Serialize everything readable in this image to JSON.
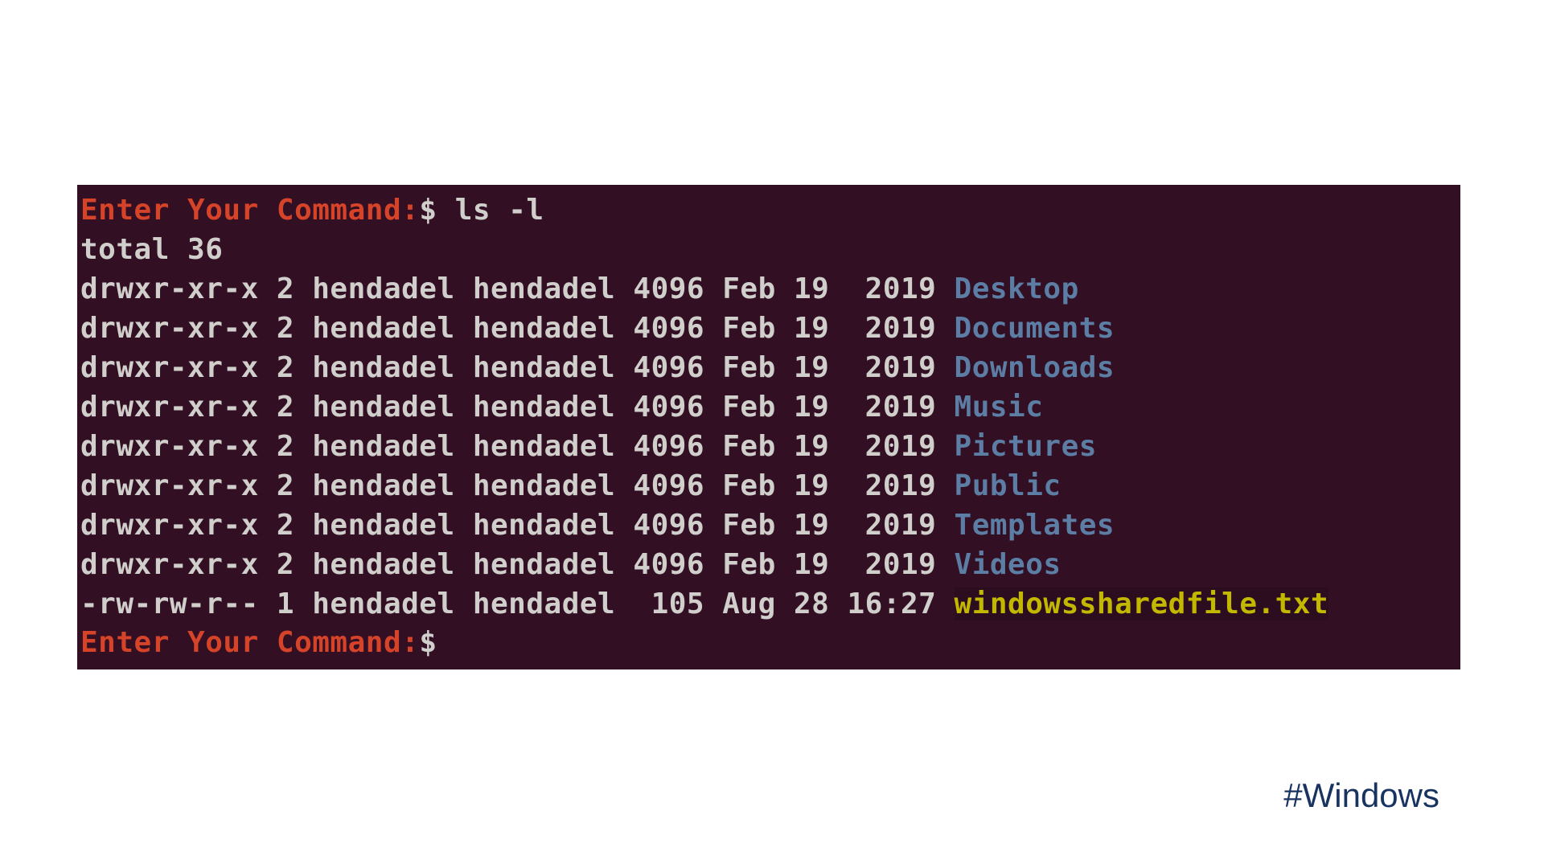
{
  "terminal": {
    "prompt_text": "Enter Your Command:",
    "dollar": "$",
    "command": "ls -l",
    "total_line": "total 36",
    "rows": [
      {
        "perm": "drwxr-xr-x",
        "links": "2",
        "owner": "hendadel",
        "group": "hendadel",
        "size": "4096",
        "month": "Feb",
        "day": "19",
        "timeyear": " 2019",
        "name": "Desktop",
        "kind": "dir"
      },
      {
        "perm": "drwxr-xr-x",
        "links": "2",
        "owner": "hendadel",
        "group": "hendadel",
        "size": "4096",
        "month": "Feb",
        "day": "19",
        "timeyear": " 2019",
        "name": "Documents",
        "kind": "dir"
      },
      {
        "perm": "drwxr-xr-x",
        "links": "2",
        "owner": "hendadel",
        "group": "hendadel",
        "size": "4096",
        "month": "Feb",
        "day": "19",
        "timeyear": " 2019",
        "name": "Downloads",
        "kind": "dir"
      },
      {
        "perm": "drwxr-xr-x",
        "links": "2",
        "owner": "hendadel",
        "group": "hendadel",
        "size": "4096",
        "month": "Feb",
        "day": "19",
        "timeyear": " 2019",
        "name": "Music",
        "kind": "dir"
      },
      {
        "perm": "drwxr-xr-x",
        "links": "2",
        "owner": "hendadel",
        "group": "hendadel",
        "size": "4096",
        "month": "Feb",
        "day": "19",
        "timeyear": " 2019",
        "name": "Pictures",
        "kind": "dir"
      },
      {
        "perm": "drwxr-xr-x",
        "links": "2",
        "owner": "hendadel",
        "group": "hendadel",
        "size": "4096",
        "month": "Feb",
        "day": "19",
        "timeyear": " 2019",
        "name": "Public",
        "kind": "dir"
      },
      {
        "perm": "drwxr-xr-x",
        "links": "2",
        "owner": "hendadel",
        "group": "hendadel",
        "size": "4096",
        "month": "Feb",
        "day": "19",
        "timeyear": " 2019",
        "name": "Templates",
        "kind": "dir"
      },
      {
        "perm": "drwxr-xr-x",
        "links": "2",
        "owner": "hendadel",
        "group": "hendadel",
        "size": "4096",
        "month": "Feb",
        "day": "19",
        "timeyear": " 2019",
        "name": "Videos",
        "kind": "dir"
      },
      {
        "perm": "-rw-rw-r--",
        "links": "1",
        "owner": "hendadel",
        "group": "hendadel",
        "size": " 105",
        "month": "Aug",
        "day": "28",
        "timeyear": "16:27",
        "name": "windowssharedfile.txt",
        "kind": "file-hl"
      }
    ]
  },
  "hashtag": "#Windows"
}
